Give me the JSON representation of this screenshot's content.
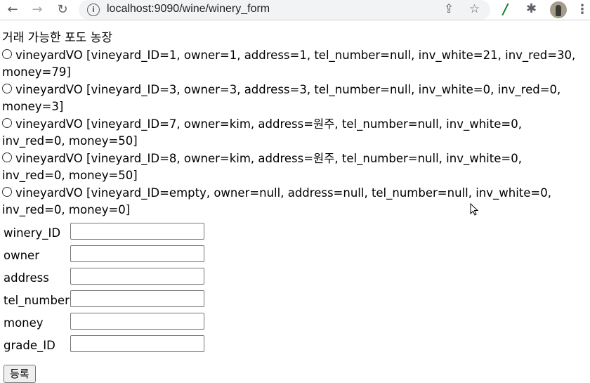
{
  "browser": {
    "url": "localhost:9090/wine/winery_form"
  },
  "page": {
    "title": "거래 가능한 포도 농장",
    "vineyards": [
      "vineyardVO [vineyard_ID=1, owner=1, address=1, tel_number=null, inv_white=21, inv_red=30, money=79]",
      "vineyardVO [vineyard_ID=3, owner=3, address=3, tel_number=null, inv_white=0, inv_red=0, money=3]",
      "vineyardVO [vineyard_ID=7, owner=kim, address=원주, tel_number=null, inv_white=0, inv_red=0, money=50]",
      "vineyardVO [vineyard_ID=8, owner=kim, address=원주, tel_number=null, inv_white=0, inv_red=0, money=50]",
      "vineyardVO [vineyard_ID=empty, owner=null, address=null, tel_number=null, inv_white=0, inv_red=0, money=0]"
    ],
    "fields": [
      {
        "label": "winery_ID",
        "value": ""
      },
      {
        "label": "owner",
        "value": ""
      },
      {
        "label": "address",
        "value": ""
      },
      {
        "label": "tel_number",
        "value": ""
      },
      {
        "label": "money",
        "value": ""
      },
      {
        "label": "grade_ID",
        "value": ""
      }
    ],
    "submit_label": "등록"
  }
}
